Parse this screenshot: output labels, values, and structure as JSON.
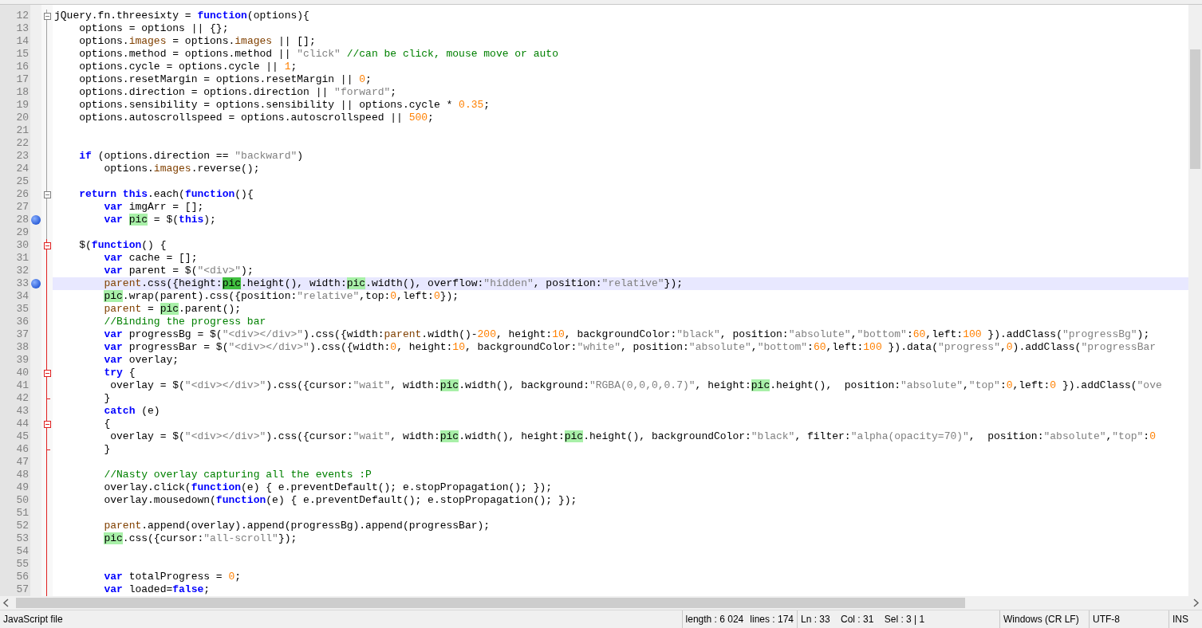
{
  "editor": {
    "lines": [
      {
        "number": "12",
        "fold_start": true,
        "tokens": [
          {
            "kind": "plain",
            "text": "jQuery.fn.threesixty = "
          },
          {
            "kind": "keyword",
            "text": "function"
          },
          {
            "kind": "plain",
            "text": "(options){"
          }
        ]
      },
      {
        "number": "13",
        "tokens": [
          {
            "kind": "plain",
            "text": "    options = options || {};"
          }
        ]
      },
      {
        "number": "14",
        "tokens": [
          {
            "kind": "plain",
            "text": "    options."
          },
          {
            "kind": "member",
            "text": "images"
          },
          {
            "kind": "plain",
            "text": " = options."
          },
          {
            "kind": "member",
            "text": "images"
          },
          {
            "kind": "plain",
            "text": " || [];"
          }
        ]
      },
      {
        "number": "15",
        "tokens": [
          {
            "kind": "plain",
            "text": "    options.method = options.method || "
          },
          {
            "kind": "string",
            "text": "\"click\""
          },
          {
            "kind": "comment",
            "text": " //can be click, mouse move or auto"
          }
        ]
      },
      {
        "number": "16",
        "tokens": [
          {
            "kind": "plain",
            "text": "    options.cycle = options.cycle || "
          },
          {
            "kind": "number",
            "text": "1"
          },
          {
            "kind": "plain",
            "text": ";"
          }
        ]
      },
      {
        "number": "17",
        "tokens": [
          {
            "kind": "plain",
            "text": "    options.resetMargin = options.resetMargin || "
          },
          {
            "kind": "number",
            "text": "0"
          },
          {
            "kind": "plain",
            "text": ";"
          }
        ]
      },
      {
        "number": "18",
        "tokens": [
          {
            "kind": "plain",
            "text": "    options.direction = options.direction || "
          },
          {
            "kind": "string",
            "text": "\"forward\""
          },
          {
            "kind": "plain",
            "text": ";"
          }
        ]
      },
      {
        "number": "19",
        "tokens": [
          {
            "kind": "plain",
            "text": "    options.sensibility = options.sensibility || options.cycle * "
          },
          {
            "kind": "number",
            "text": "0.35"
          },
          {
            "kind": "plain",
            "text": ";"
          }
        ]
      },
      {
        "number": "20",
        "tokens": [
          {
            "kind": "plain",
            "text": "    options.autoscrollspeed = options.autoscrollspeed || "
          },
          {
            "kind": "number",
            "text": "500"
          },
          {
            "kind": "plain",
            "text": ";"
          }
        ]
      },
      {
        "number": "21"
      },
      {
        "number": "22"
      },
      {
        "number": "23",
        "tokens": [
          {
            "kind": "keyword",
            "text": "    if"
          },
          {
            "kind": "plain",
            "text": " (options.direction == "
          },
          {
            "kind": "string",
            "text": "\"backward\""
          },
          {
            "kind": "plain",
            "text": ")"
          }
        ]
      },
      {
        "number": "24",
        "tokens": [
          {
            "kind": "plain",
            "text": "        options."
          },
          {
            "kind": "member",
            "text": "images"
          },
          {
            "kind": "plain",
            "text": ".reverse();"
          }
        ]
      },
      {
        "number": "25"
      },
      {
        "number": "26",
        "fold_start": true,
        "tokens": [
          {
            "kind": "keyword",
            "text": "    return"
          },
          {
            "kind": "keyword",
            "text": " this"
          },
          {
            "kind": "plain",
            "text": ".each("
          },
          {
            "kind": "keyword",
            "text": "function"
          },
          {
            "kind": "plain",
            "text": "(){"
          }
        ]
      },
      {
        "number": "27",
        "tokens": [
          {
            "kind": "keyword",
            "text": "        var"
          },
          {
            "kind": "plain",
            "text": " imgArr = [];"
          }
        ]
      },
      {
        "number": "28",
        "bookmark": true,
        "tokens": [
          {
            "kind": "keyword",
            "text": "        var"
          },
          {
            "kind": "match",
            "text": " pic"
          },
          {
            "kind": "plain",
            "text": " = $("
          },
          {
            "kind": "keyword",
            "text": "this"
          },
          {
            "kind": "plain",
            "text": ");"
          }
        ]
      },
      {
        "number": "29"
      },
      {
        "number": "30",
        "fold_start": true,
        "active_block": true,
        "tokens": [
          {
            "kind": "plain",
            "text": "    $("
          },
          {
            "kind": "keyword",
            "text": "function"
          },
          {
            "kind": "plain",
            "text": "() {"
          }
        ]
      },
      {
        "number": "31",
        "active_block": true,
        "tokens": [
          {
            "kind": "keyword",
            "text": "        var"
          },
          {
            "kind": "plain",
            "text": " cache = [];"
          }
        ]
      },
      {
        "number": "32",
        "active_block": true,
        "tokens": [
          {
            "kind": "keyword",
            "text": "        var"
          },
          {
            "kind": "plain",
            "text": " parent = $("
          },
          {
            "kind": "string",
            "text": "\"<div>\""
          },
          {
            "kind": "plain",
            "text": ");"
          }
        ]
      },
      {
        "number": "33",
        "bookmark": true,
        "current": true,
        "active_block": true,
        "tokens": [
          {
            "kind": "member",
            "text": "        parent"
          },
          {
            "kind": "plain",
            "text": ".css({height:"
          },
          {
            "kind": "match_selected",
            "text": "pic"
          },
          {
            "kind": "plain",
            "text": ".height(), width:"
          },
          {
            "kind": "match",
            "text": "pic"
          },
          {
            "kind": "plain",
            "text": ".width(), overflow:"
          },
          {
            "kind": "string",
            "text": "\"hidden\""
          },
          {
            "kind": "plain",
            "text": ", position:"
          },
          {
            "kind": "string",
            "text": "\"relative\""
          },
          {
            "kind": "plain",
            "text": "});"
          }
        ]
      },
      {
        "number": "34",
        "active_block": true,
        "tokens": [
          {
            "kind": "match",
            "text": "        pic"
          },
          {
            "kind": "plain",
            "text": ".wrap(parent).css({position:"
          },
          {
            "kind": "string",
            "text": "\"relative\""
          },
          {
            "kind": "plain",
            "text": ",top:"
          },
          {
            "kind": "number",
            "text": "0"
          },
          {
            "kind": "plain",
            "text": ",left:"
          },
          {
            "kind": "number",
            "text": "0"
          },
          {
            "kind": "plain",
            "text": "});"
          }
        ]
      },
      {
        "number": "35",
        "active_block": true,
        "tokens": [
          {
            "kind": "member",
            "text": "        parent"
          },
          {
            "kind": "plain",
            "text": " = "
          },
          {
            "kind": "match",
            "text": "pic"
          },
          {
            "kind": "plain",
            "text": ".parent();"
          }
        ]
      },
      {
        "number": "36",
        "active_block": true,
        "tokens": [
          {
            "kind": "comment",
            "text": "        //Binding the progress bar"
          }
        ]
      },
      {
        "number": "37",
        "active_block": true,
        "tokens": [
          {
            "kind": "keyword",
            "text": "        var"
          },
          {
            "kind": "plain",
            "text": " progressBg = $("
          },
          {
            "kind": "string",
            "text": "\"<div></div>\""
          },
          {
            "kind": "plain",
            "text": ").css({width:"
          },
          {
            "kind": "member",
            "text": "parent"
          },
          {
            "kind": "plain",
            "text": ".width()-"
          },
          {
            "kind": "number",
            "text": "200"
          },
          {
            "kind": "plain",
            "text": ", height:"
          },
          {
            "kind": "number",
            "text": "10"
          },
          {
            "kind": "plain",
            "text": ", backgroundColor:"
          },
          {
            "kind": "string",
            "text": "\"black\""
          },
          {
            "kind": "plain",
            "text": ", position:"
          },
          {
            "kind": "string",
            "text": "\"absolute\""
          },
          {
            "kind": "plain",
            "text": ","
          },
          {
            "kind": "string",
            "text": "\"bottom\""
          },
          {
            "kind": "plain",
            "text": ":"
          },
          {
            "kind": "number",
            "text": "60"
          },
          {
            "kind": "plain",
            "text": ",left:"
          },
          {
            "kind": "number",
            "text": "100"
          },
          {
            "kind": "plain",
            "text": " }).addClass("
          },
          {
            "kind": "string",
            "text": "\"progressBg\""
          },
          {
            "kind": "plain",
            "text": ");"
          }
        ]
      },
      {
        "number": "38",
        "active_block": true,
        "tokens": [
          {
            "kind": "keyword",
            "text": "        var"
          },
          {
            "kind": "plain",
            "text": " progressBar = $("
          },
          {
            "kind": "string",
            "text": "\"<div></div>\""
          },
          {
            "kind": "plain",
            "text": ").css({width:"
          },
          {
            "kind": "number",
            "text": "0"
          },
          {
            "kind": "plain",
            "text": ", height:"
          },
          {
            "kind": "number",
            "text": "10"
          },
          {
            "kind": "plain",
            "text": ", backgroundColor:"
          },
          {
            "kind": "string",
            "text": "\"white\""
          },
          {
            "kind": "plain",
            "text": ", position:"
          },
          {
            "kind": "string",
            "text": "\"absolute\""
          },
          {
            "kind": "plain",
            "text": ","
          },
          {
            "kind": "string",
            "text": "\"bottom\""
          },
          {
            "kind": "plain",
            "text": ":"
          },
          {
            "kind": "number",
            "text": "60"
          },
          {
            "kind": "plain",
            "text": ",left:"
          },
          {
            "kind": "number",
            "text": "100"
          },
          {
            "kind": "plain",
            "text": " }).data("
          },
          {
            "kind": "string",
            "text": "\"progress\""
          },
          {
            "kind": "plain",
            "text": ","
          },
          {
            "kind": "number",
            "text": "0"
          },
          {
            "kind": "plain",
            "text": ").addClass("
          },
          {
            "kind": "string",
            "text": "\"progressBar"
          }
        ]
      },
      {
        "number": "39",
        "active_block": true,
        "tokens": [
          {
            "kind": "keyword",
            "text": "        var"
          },
          {
            "kind": "plain",
            "text": " overlay;"
          }
        ]
      },
      {
        "number": "40",
        "fold_start": true,
        "active_block": true,
        "tokens": [
          {
            "kind": "keyword",
            "text": "        try"
          },
          {
            "kind": "plain",
            "text": " {"
          }
        ]
      },
      {
        "number": "41",
        "active_block": true,
        "tokens": [
          {
            "kind": "plain",
            "text": "         overlay = $("
          },
          {
            "kind": "string",
            "text": "\"<div></div>\""
          },
          {
            "kind": "plain",
            "text": ").css({cursor:"
          },
          {
            "kind": "string",
            "text": "\"wait\""
          },
          {
            "kind": "plain",
            "text": ", width:"
          },
          {
            "kind": "match",
            "text": "pic"
          },
          {
            "kind": "plain",
            "text": ".width(), background:"
          },
          {
            "kind": "string",
            "text": "\"RGBA(0,0,0,0.7)\""
          },
          {
            "kind": "plain",
            "text": ", height:"
          },
          {
            "kind": "match",
            "text": "pic"
          },
          {
            "kind": "plain",
            "text": ".height(),  position:"
          },
          {
            "kind": "string",
            "text": "\"absolute\""
          },
          {
            "kind": "plain",
            "text": ","
          },
          {
            "kind": "string",
            "text": "\"top\""
          },
          {
            "kind": "plain",
            "text": ":"
          },
          {
            "kind": "number",
            "text": "0"
          },
          {
            "kind": "plain",
            "text": ",left:"
          },
          {
            "kind": "number",
            "text": "0"
          },
          {
            "kind": "plain",
            "text": " }).addClass("
          },
          {
            "kind": "string",
            "text": "\"ove"
          }
        ]
      },
      {
        "number": "42",
        "fold_end": true,
        "active_block": true,
        "tokens": [
          {
            "kind": "plain",
            "text": "        }"
          }
        ]
      },
      {
        "number": "43",
        "active_block": true,
        "tokens": [
          {
            "kind": "keyword",
            "text": "        catch"
          },
          {
            "kind": "plain",
            "text": " (e)"
          }
        ]
      },
      {
        "number": "44",
        "fold_start": true,
        "active_block": true,
        "tokens": [
          {
            "kind": "plain",
            "text": "        {"
          }
        ]
      },
      {
        "number": "45",
        "active_block": true,
        "tokens": [
          {
            "kind": "plain",
            "text": "         overlay = $("
          },
          {
            "kind": "string",
            "text": "\"<div></div>\""
          },
          {
            "kind": "plain",
            "text": ").css({cursor:"
          },
          {
            "kind": "string",
            "text": "\"wait\""
          },
          {
            "kind": "plain",
            "text": ", width:"
          },
          {
            "kind": "match",
            "text": "pic"
          },
          {
            "kind": "plain",
            "text": ".width(), height:"
          },
          {
            "kind": "match",
            "text": "pic"
          },
          {
            "kind": "plain",
            "text": ".height(), backgroundColor:"
          },
          {
            "kind": "string",
            "text": "\"black\""
          },
          {
            "kind": "plain",
            "text": ", filter:"
          },
          {
            "kind": "string",
            "text": "\"alpha(opacity=70)\""
          },
          {
            "kind": "plain",
            "text": ",  position:"
          },
          {
            "kind": "string",
            "text": "\"absolute\""
          },
          {
            "kind": "plain",
            "text": ","
          },
          {
            "kind": "string",
            "text": "\"top\""
          },
          {
            "kind": "plain",
            "text": ":"
          },
          {
            "kind": "number",
            "text": "0"
          }
        ]
      },
      {
        "number": "46",
        "fold_end": true,
        "active_block": true,
        "tokens": [
          {
            "kind": "plain",
            "text": "        }"
          }
        ]
      },
      {
        "number": "47",
        "active_block": true
      },
      {
        "number": "48",
        "active_block": true,
        "tokens": [
          {
            "kind": "comment",
            "text": "        //Nasty overlay capturing all the events :P"
          }
        ]
      },
      {
        "number": "49",
        "active_block": true,
        "tokens": [
          {
            "kind": "plain",
            "text": "        overlay.click("
          },
          {
            "kind": "keyword",
            "text": "function"
          },
          {
            "kind": "plain",
            "text": "(e) { e.preventDefault(); e.stopPropagation(); });"
          }
        ]
      },
      {
        "number": "50",
        "active_block": true,
        "tokens": [
          {
            "kind": "plain",
            "text": "        overlay.mousedown("
          },
          {
            "kind": "keyword",
            "text": "function"
          },
          {
            "kind": "plain",
            "text": "(e) { e.preventDefault(); e.stopPropagation(); });"
          }
        ]
      },
      {
        "number": "51",
        "active_block": true
      },
      {
        "number": "52",
        "active_block": true,
        "tokens": [
          {
            "kind": "member",
            "text": "        parent"
          },
          {
            "kind": "plain",
            "text": ".append(overlay).append(progressBg).append(progressBar);"
          }
        ]
      },
      {
        "number": "53",
        "active_block": true,
        "tokens": [
          {
            "kind": "match",
            "text": "        pic"
          },
          {
            "kind": "plain",
            "text": ".css({cursor:"
          },
          {
            "kind": "string",
            "text": "\"all-scroll\""
          },
          {
            "kind": "plain",
            "text": "});"
          }
        ]
      },
      {
        "number": "54",
        "active_block": true
      },
      {
        "number": "55",
        "active_block": true
      },
      {
        "number": "56",
        "active_block": true,
        "tokens": [
          {
            "kind": "keyword",
            "text": "        var"
          },
          {
            "kind": "plain",
            "text": " totalProgress = "
          },
          {
            "kind": "number",
            "text": "0"
          },
          {
            "kind": "plain",
            "text": ";"
          }
        ]
      },
      {
        "number": "57",
        "active_block": true,
        "tokens": [
          {
            "kind": "keyword",
            "text": "        var"
          },
          {
            "kind": "plain",
            "text": " loaded="
          },
          {
            "kind": "keyword",
            "text": "false"
          },
          {
            "kind": "plain",
            "text": ";"
          }
        ]
      }
    ]
  },
  "status_bar": {
    "file_type": "JavaScript file",
    "length": "length : 6 024",
    "lines": "lines : 174",
    "position": "Ln : 33    Col : 31    Sel : 3 | 1",
    "eol": "Windows (CR LF)",
    "encoding": "UTF-8",
    "mode": "INS"
  }
}
